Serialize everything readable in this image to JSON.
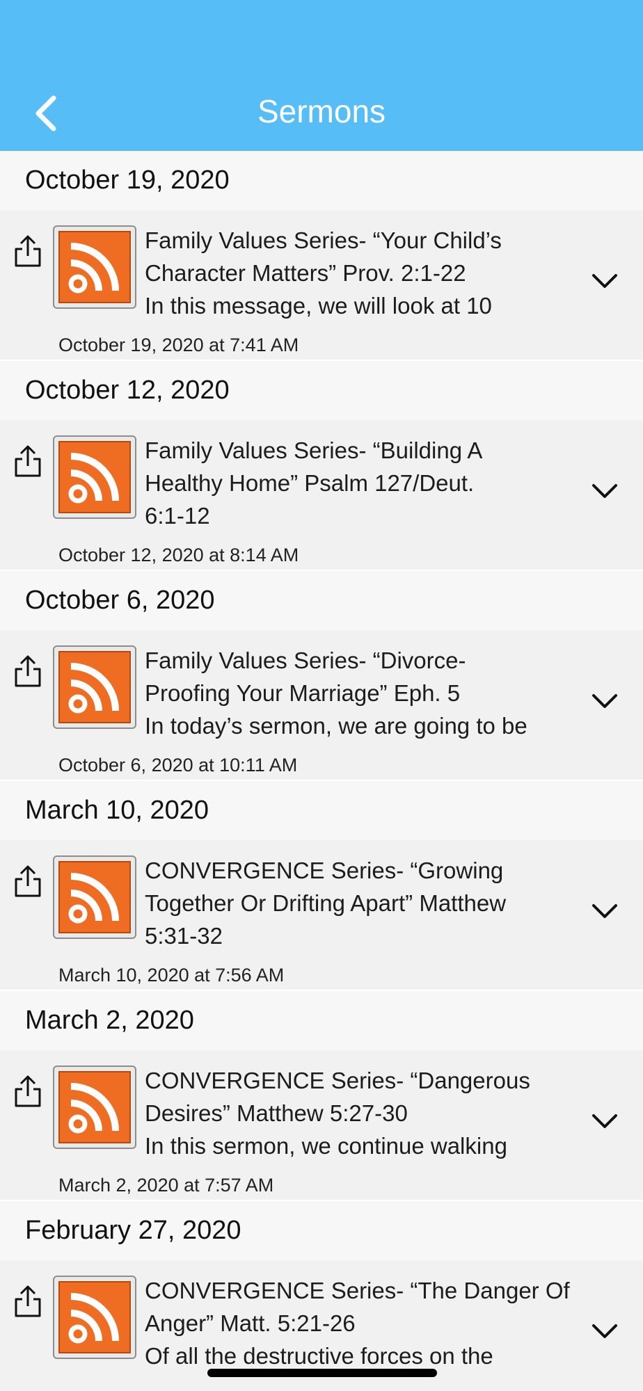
{
  "nav": {
    "title": "Sermons",
    "back_icon": "chevron-left-icon"
  },
  "colors": {
    "nav_bg": "#56bdf6",
    "rss_orange": "#ef6d23"
  },
  "sections": [
    {
      "header": "October 19, 2020",
      "item": {
        "lines": [
          "Family Values Series- “Your Child’s",
          "Character Matters” Prov. 2:1-22",
          "In this message, we will look at 10"
        ],
        "date": "October 19, 2020 at 7:41 AM"
      }
    },
    {
      "header": "October 12, 2020",
      "item": {
        "lines": [
          "Family Values Series- “Building A",
          "Healthy Home” Psalm 127/Deut.",
          "6:1-12"
        ],
        "date": "October 12, 2020 at 8:14 AM"
      }
    },
    {
      "header": "October 6, 2020",
      "item": {
        "lines": [
          "Family Values Series- “Divorce-",
          "Proofing Your Marriage” Eph. 5",
          "In today’s sermon, we are going to be"
        ],
        "date": "October 6, 2020 at 10:11 AM"
      }
    },
    {
      "header": "March 10, 2020",
      "item": {
        "lines": [
          "CONVERGENCE Series- “Growing",
          "Together Or Drifting Apart” Matthew",
          "5:31-32"
        ],
        "date": "March 10, 2020 at 7:56 AM"
      }
    },
    {
      "header": "March 2, 2020",
      "item": {
        "lines": [
          "CONVERGENCE Series- “Dangerous",
          "Desires” Matthew 5:27-30",
          "In this sermon, we continue walking"
        ],
        "date": "March 2, 2020 at 7:57 AM"
      }
    },
    {
      "header": "February 27, 2020",
      "item": {
        "lines": [
          "CONVERGENCE Series- “The Danger Of",
          "Anger” Matt. 5:21-26",
          "Of all the destructive forces on the"
        ],
        "date": ""
      }
    }
  ]
}
